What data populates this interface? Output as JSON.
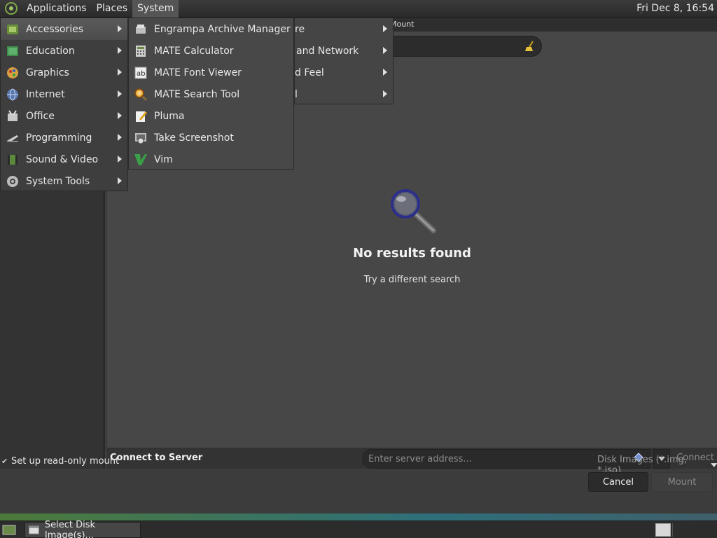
{
  "top_panel": {
    "menus": [
      "Applications",
      "Places",
      "System"
    ],
    "clock": "Fri Dec  8, 16:54"
  },
  "applications_menu": {
    "items": [
      {
        "label": "Accessories",
        "icon": "accessories-icon"
      },
      {
        "label": "Education",
        "icon": "education-icon"
      },
      {
        "label": "Graphics",
        "icon": "graphics-icon"
      },
      {
        "label": "Internet",
        "icon": "internet-icon"
      },
      {
        "label": "Office",
        "icon": "office-icon"
      },
      {
        "label": "Programming",
        "icon": "programming-icon"
      },
      {
        "label": "Sound & Video",
        "icon": "sound-video-icon"
      },
      {
        "label": "System Tools",
        "icon": "system-tools-icon"
      }
    ]
  },
  "accessories_menu": {
    "items": [
      {
        "label": "Engrampa Archive Manager",
        "icon": "archive-manager-icon"
      },
      {
        "label": "MATE Calculator",
        "icon": "calculator-icon"
      },
      {
        "label": "MATE Font Viewer",
        "icon": "font-viewer-icon"
      },
      {
        "label": "MATE Search Tool",
        "icon": "search-tool-icon"
      },
      {
        "label": "Pluma",
        "icon": "text-editor-icon"
      },
      {
        "label": "Take Screenshot",
        "icon": "screenshot-icon"
      },
      {
        "label": "Vim",
        "icon": "vim-icon"
      }
    ]
  },
  "system_menu_visible": {
    "items": [
      "re",
      "and Network",
      "d Feel",
      "l"
    ]
  },
  "dialog": {
    "title_fragment": "Mount",
    "empty_title": "No results found",
    "empty_subtitle": "Try a different search",
    "connect_label": "Connect to Server",
    "server_placeholder": "Enter server address...",
    "connect_button": "Connect",
    "readonly_checkbox": "Set up read-only mount",
    "readonly_checked": true,
    "filter": "Disk Images (*.img, *.iso)",
    "cancel_button": "Cancel",
    "mount_button": "Mount"
  },
  "taskbar": {
    "window_button": "Select Disk Image(s)..."
  },
  "colors": {
    "panel": "#2b2b2b",
    "menu_bg": "#3e3e3e",
    "content_bg": "#474747",
    "accent_green": "#7fa64a"
  }
}
